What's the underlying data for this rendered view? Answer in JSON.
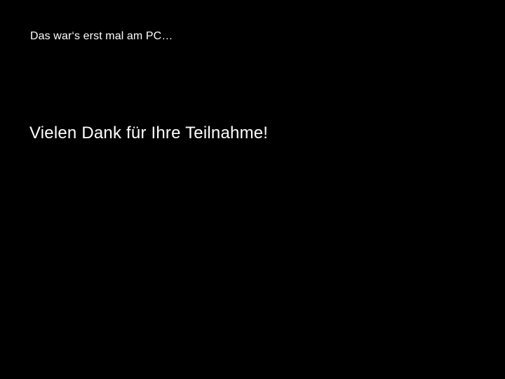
{
  "slide": {
    "top_text": "Das war‘s erst mal am PC…",
    "main_text": "Vielen Dank für Ihre Teilnahme!",
    "background_color": "#000000",
    "text_color": "#ffffff"
  }
}
